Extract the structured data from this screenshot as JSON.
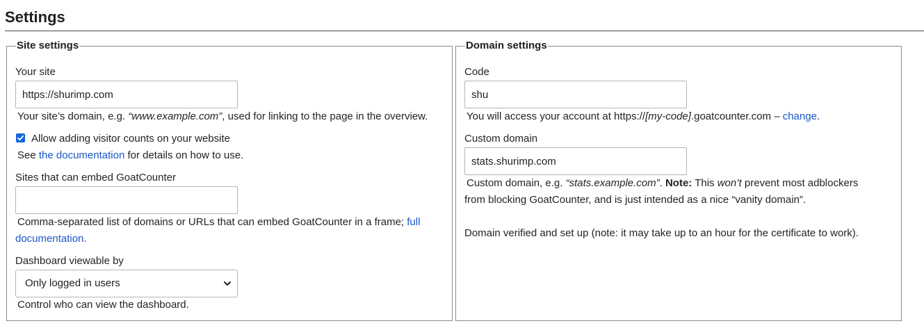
{
  "page": {
    "title": "Settings"
  },
  "site_settings": {
    "legend": "Site settings",
    "your_site": {
      "label": "Your site",
      "value": "https://shurimp.com",
      "help_prefix": "Your site’s domain, e.g. ",
      "help_example": "“www.example.com”",
      "help_suffix": ", used for linking to the page in the overview."
    },
    "allow_counter": {
      "checked": true,
      "label": "Allow adding visitor counts on your website",
      "see_prefix": "See ",
      "see_link": "the documentation",
      "see_suffix": " for details on how to use."
    },
    "embed": {
      "label": "Sites that can embed GoatCounter",
      "value": "",
      "help_text": "Comma-separated list of domains or URLs that can embed GoatCounter in a frame; ",
      "help_link_1": "full",
      "help_link_2": "documentation",
      "help_end": "."
    },
    "dashboard": {
      "label": "Dashboard viewable by",
      "selected": "Only logged in users",
      "help": "Control who can view the dashboard."
    }
  },
  "domain_settings": {
    "legend": "Domain settings",
    "code": {
      "label": "Code",
      "value": "shu",
      "help_prefix": "You will access your account at https://",
      "help_placeholder": "[my-code]",
      "help_suffix": ".goatcounter.com – ",
      "change_link": "change",
      "help_end": "."
    },
    "custom_domain": {
      "label": "Custom domain",
      "value": "stats.shurimp.com",
      "help_prefix": "Custom domain, e.g. ",
      "help_example": "“stats.example.com”",
      "help_dot": ". ",
      "note_label": "Note:",
      "help_mid": " This ",
      "help_wont": "won’t",
      "help_rest": " prevent most adblockers",
      "help_line2": "from blocking GoatCounter, and is just intended as a nice “vanity domain”.",
      "status": "Domain verified and set up (note: it may take up to an hour for the certificate to work)."
    }
  },
  "colors": {
    "link": "#1a57c9",
    "checkbox": "#1565d8",
    "border": "#8a8a8a"
  },
  "icons": {
    "checkbox": "checkmark-icon",
    "select": "chevron-down-icon"
  }
}
